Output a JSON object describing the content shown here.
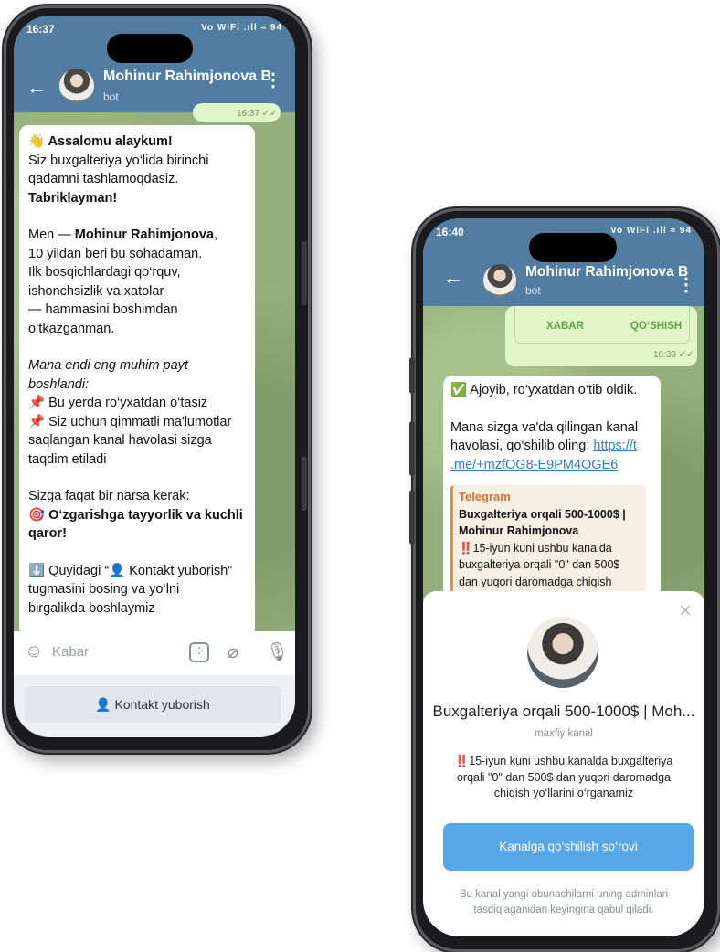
{
  "phone1": {
    "status_time": "16:37",
    "status_icons": "Vo WiFi .ıll ≈ 94",
    "header": {
      "name": "Mohinur Rahimjonova B",
      "subtitle": "bot"
    },
    "message_lines": [
      {
        "text": "👋 Assalomu alaykum!",
        "style": "b"
      },
      {
        "text": "Siz buxgalteriya yo‘lida birinchi",
        "style": ""
      },
      {
        "text": "qadamni tashlamoqdasiz.",
        "style": ""
      },
      {
        "text": "Tabriklayman!",
        "style": "b"
      },
      {
        "text": "",
        "style": "gap"
      },
      {
        "text": "Men — ",
        "bold": "Mohinur Rahimjonova",
        "tail": ",",
        "style": "mixed"
      },
      {
        "text": "10 yildan beri bu sohadaman.",
        "style": ""
      },
      {
        "text": "Ilk bosqichlardagi qo‘rquv,",
        "style": ""
      },
      {
        "text": "ishonchsizlik va xatolar",
        "style": ""
      },
      {
        "text": "— hammasini boshimdan",
        "style": ""
      },
      {
        "text": "o‘tkazganman.",
        "style": ""
      },
      {
        "text": "",
        "style": "gap"
      },
      {
        "text": "Mana endi eng muhim payt",
        "style": "i"
      },
      {
        "text": "boshlandi:",
        "style": "i"
      },
      {
        "text": "📌 Bu yerda ro‘yxatdan o‘tasiz",
        "style": ""
      },
      {
        "text": "📌 Siz uchun qimmatli ma'lumotlar",
        "style": ""
      },
      {
        "text": "saqlangan kanal havolasi sizga",
        "style": ""
      },
      {
        "text": "taqdim etiladi",
        "style": ""
      },
      {
        "text": "",
        "style": "gap"
      },
      {
        "text": "Sizga faqat bir narsa kerak:",
        "style": ""
      },
      {
        "text": "🎯 O‘zgarishga tayyorlik va kuchli",
        "style": "b"
      },
      {
        "text": "qaror!",
        "style": "b"
      },
      {
        "text": "",
        "style": "gap"
      },
      {
        "text": "⬇️ Quyidagi “👤 Kontakt yuborish”",
        "style": ""
      },
      {
        "text": "tugmasini bosing va yo‘lni",
        "style": ""
      },
      {
        "text": "birgalikda boshlaymiz",
        "style": ""
      }
    ],
    "input_placeholder": "Kabar",
    "keyboard_button": "👤 Kontakt yuborish",
    "prev_time": "16:37 ✓✓"
  },
  "phone2": {
    "status_time": "16:40",
    "status_icons": "Vo WiFi .ıll ≈ 94",
    "header": {
      "name": "Mohinur Rahimjonova B",
      "subtitle": "bot"
    },
    "prev_buttons": [
      "XABAR",
      "QO‘SHISH"
    ],
    "prev_time": "16:39 ✓✓",
    "message": {
      "line1": "✅ Ajoyib, ro‘yxatdan o‘tib oldik.",
      "line2": "Mana sizga va'da qilingan kanal",
      "line3": "havolasi, qo‘shilib oling: ",
      "link_a": "https://t",
      "link_b": ".me/+mzfOG8-E9PM4OGE6"
    },
    "preview": {
      "site": "Telegram",
      "title1": "Buxgalteriya orqali 500-1000$ |",
      "title2": "Mohinur Rahimjonova",
      "desc1": "‼️15-iyun kuni ushbu kanalda",
      "desc2": "buxgalteriya orqali \"0\" dan 500$",
      "desc3": "dan yuqori daromadga chiqish"
    },
    "sheet": {
      "close": "×",
      "title": "Buxgalteriya orqali 500-1000$ | Moh...",
      "subtitle": "maxfiy kanal",
      "desc1": "‼️15-iyun kuni ushbu kanalda buxgalteriya",
      "desc2": "orqali \"0\" dan 500$ dan yuqori daromadga",
      "desc3": "chiqish yo‘llarini o‘rganamiz",
      "button": "Kanalga qo‘shilish so‘rovi",
      "note1": "Bu kanal yangi obunachilarni uning adminlari",
      "note2": "tasdiqlaganidan keyingina qabul qiladi."
    }
  }
}
